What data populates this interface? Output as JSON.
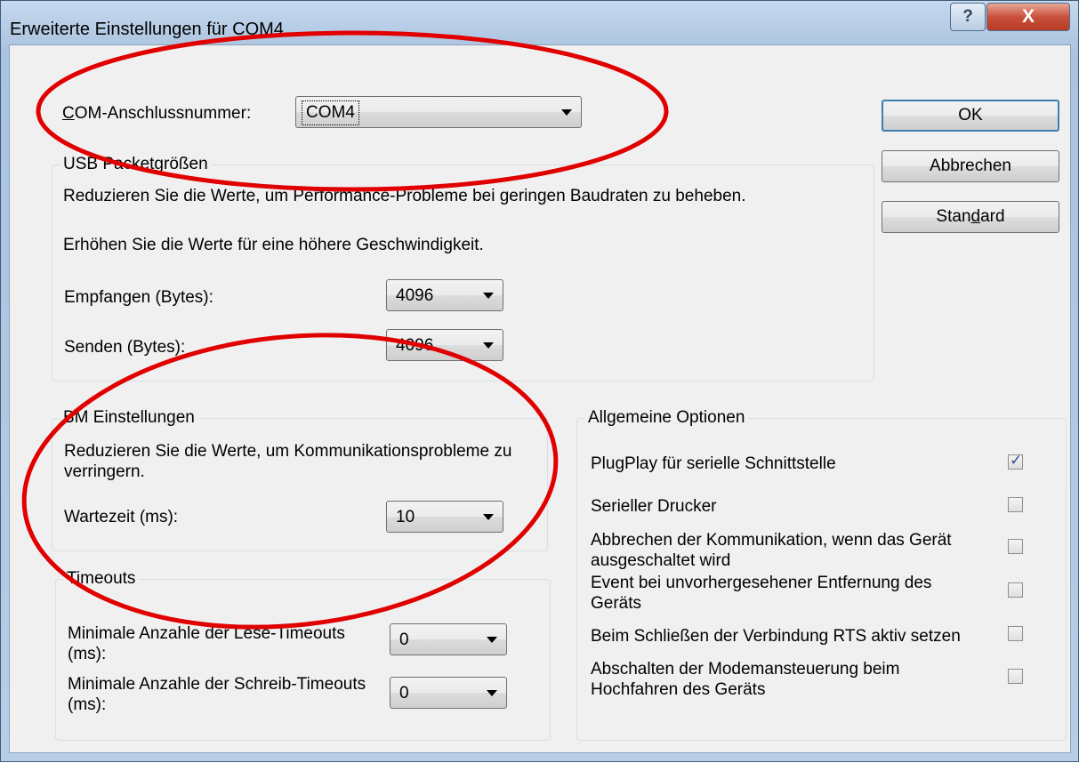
{
  "window": {
    "title": "Erweiterte Einstellungen für COM4",
    "help_glyph": "?",
    "close_glyph": "X"
  },
  "com_port": {
    "label": "COM-Anschlussnummer:",
    "label_underline": "C",
    "label_rest": "OM-Anschlussnummer:",
    "value": "COM4"
  },
  "buttons": {
    "ok": "OK",
    "cancel": "Abbrechen",
    "default_pre": "Stan",
    "default_u": "d",
    "default_post": "ard"
  },
  "usb": {
    "title": "USB Packetgrößen",
    "desc1": "Reduzieren Sie die Werte, um Performance-Probleme bei geringen Baudraten zu beheben.",
    "desc2": "Erhöhen Sie die Werte für eine höhere Geschwindigkeit.",
    "receive_label": "Empfangen (Bytes):",
    "receive_value": "4096",
    "send_label": "Senden (Bytes):",
    "send_value": "4096"
  },
  "bm": {
    "title": "BM Einstellungen",
    "desc": "Reduzieren Sie die Werte, um Kommunikationsprobleme zu verringern.",
    "latency_label": "Wartezeit (ms):",
    "latency_value": "10"
  },
  "timeouts": {
    "title": "Timeouts",
    "read_label": "Minimale Anzahle der Lese-Timeouts (ms):",
    "read_value": "0",
    "write_label": "Minimale Anzahle der Schreib-Timeouts (ms):",
    "write_value": "0"
  },
  "options": {
    "title": "Allgemeine Optionen",
    "items": [
      {
        "label": "PlugPlay für serielle Schnittstelle",
        "checked": true
      },
      {
        "label": "Serieller Drucker",
        "checked": false
      },
      {
        "label": "Abbrechen der Kommunikation, wenn das Gerät ausgeschaltet wird",
        "checked": false
      },
      {
        "label": "Event bei unvorhergesehener Entfernung des Geräts",
        "checked": false
      },
      {
        "label": "Beim Schließen der Verbindung RTS aktiv setzen",
        "checked": false
      },
      {
        "label": "Abschalten der Modemansteuerung beim Hochfahren des Geräts",
        "checked": false
      }
    ],
    "check_glyph": "✓"
  },
  "colors": {
    "annotation": "#e00000",
    "title_bar": "#b3c9e3",
    "dialog_bg": "#f0f0f0"
  }
}
